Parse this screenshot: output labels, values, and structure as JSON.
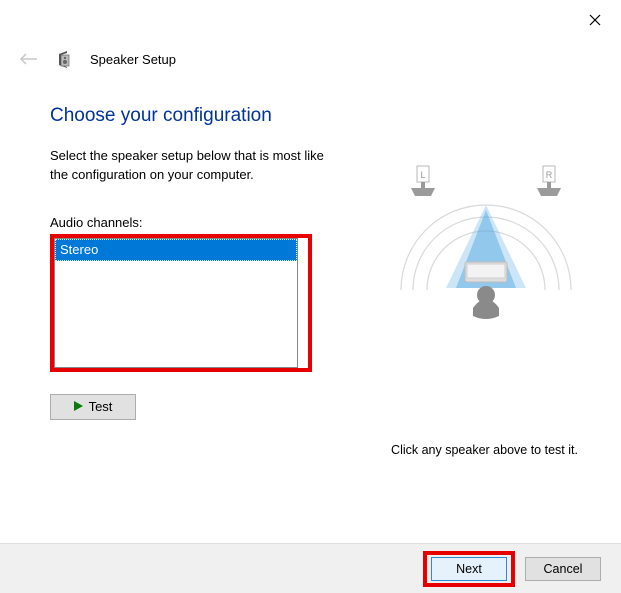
{
  "window": {
    "title": "Speaker Setup"
  },
  "page": {
    "heading": "Choose your configuration",
    "description": "Select the speaker setup below that is most like the configuration on your computer.",
    "channels_label": "Audio channels:",
    "selected_channel": "Stereo",
    "test_button": "Test",
    "hint": "Click any speaker above to test it."
  },
  "diagram": {
    "left_label": "L",
    "right_label": "R"
  },
  "footer": {
    "next": "Next",
    "cancel": "Cancel"
  }
}
